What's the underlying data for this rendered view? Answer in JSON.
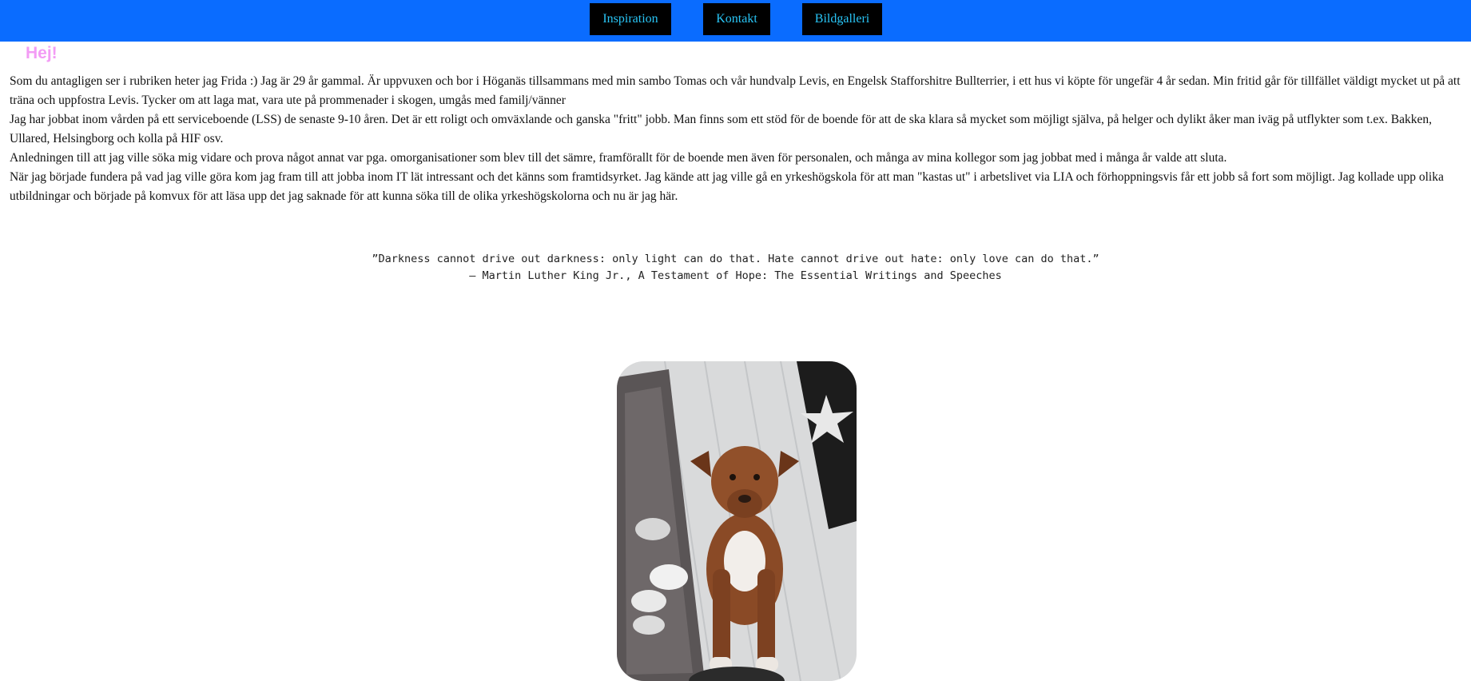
{
  "nav": {
    "items": [
      {
        "label": "Inspiration"
      },
      {
        "label": "Kontakt"
      },
      {
        "label": "Bildgalleri"
      }
    ]
  },
  "header": {
    "greeting": "Hej!"
  },
  "main": {
    "paragraphs": [
      "Som du antagligen ser i rubriken heter jag Frida :) Jag är 29 år gammal. Är uppvuxen och bor i Höganäs tillsammans med min sambo Tomas och vår hundvalp Levis, en Engelsk Stafforshitre Bullterrier, i ett hus vi köpte för ungefär 4 år sedan. Min fritid går för tillfället väldigt mycket ut på att träna och uppfostra Levis. Tycker om att laga mat, vara ute på prommenader i skogen, umgås med familj/vänner",
      "Jag har jobbat inom vården på ett serviceboende (LSS) de senaste 9-10 åren. Det är ett roligt och omväxlande och ganska \"fritt\" jobb. Man finns som ett stöd för de boende för att de ska klara så mycket som möjligt själva, på helger och dylikt åker man iväg på utflykter som t.ex. Bakken, Ullared, Helsingborg och kolla på HIF osv.",
      "Anledningen till att jag ville söka mig vidare och prova något annat var pga. omorganisationer som blev till det sämre, framförallt för de boende men även för personalen, och många av mina kollegor som jag jobbat med i många år valde att sluta.",
      "När jag började fundera på vad jag ville göra kom jag fram till att jobba inom IT lät intressant och det känns som framtidsyrket. Jag kände att jag ville gå en yrkeshögskola för att man \"kastas ut\" i arbetslivet via LIA och förhoppningsvis får ett jobb så fort som möjligt. Jag kollade upp olika utbildningar och började på komvux för att läsa upp det jag saknade för att kunna söka till de olika yrkeshögskolorna och nu är jag här."
    ]
  },
  "quote": {
    "text": "”Darkness cannot drive out darkness: only light can do that. Hate cannot drive out hate: only love can do that.”",
    "attribution": "― Martin Luther King Jr., A Testament of Hope: The Essential Writings and Speeches"
  },
  "colors": {
    "topbar": "#0a6cff",
    "nav_bg": "#000000",
    "nav_text": "#29c5f6",
    "greeting": "#f39cf5"
  },
  "photo": {
    "icon": "dog-photo"
  }
}
